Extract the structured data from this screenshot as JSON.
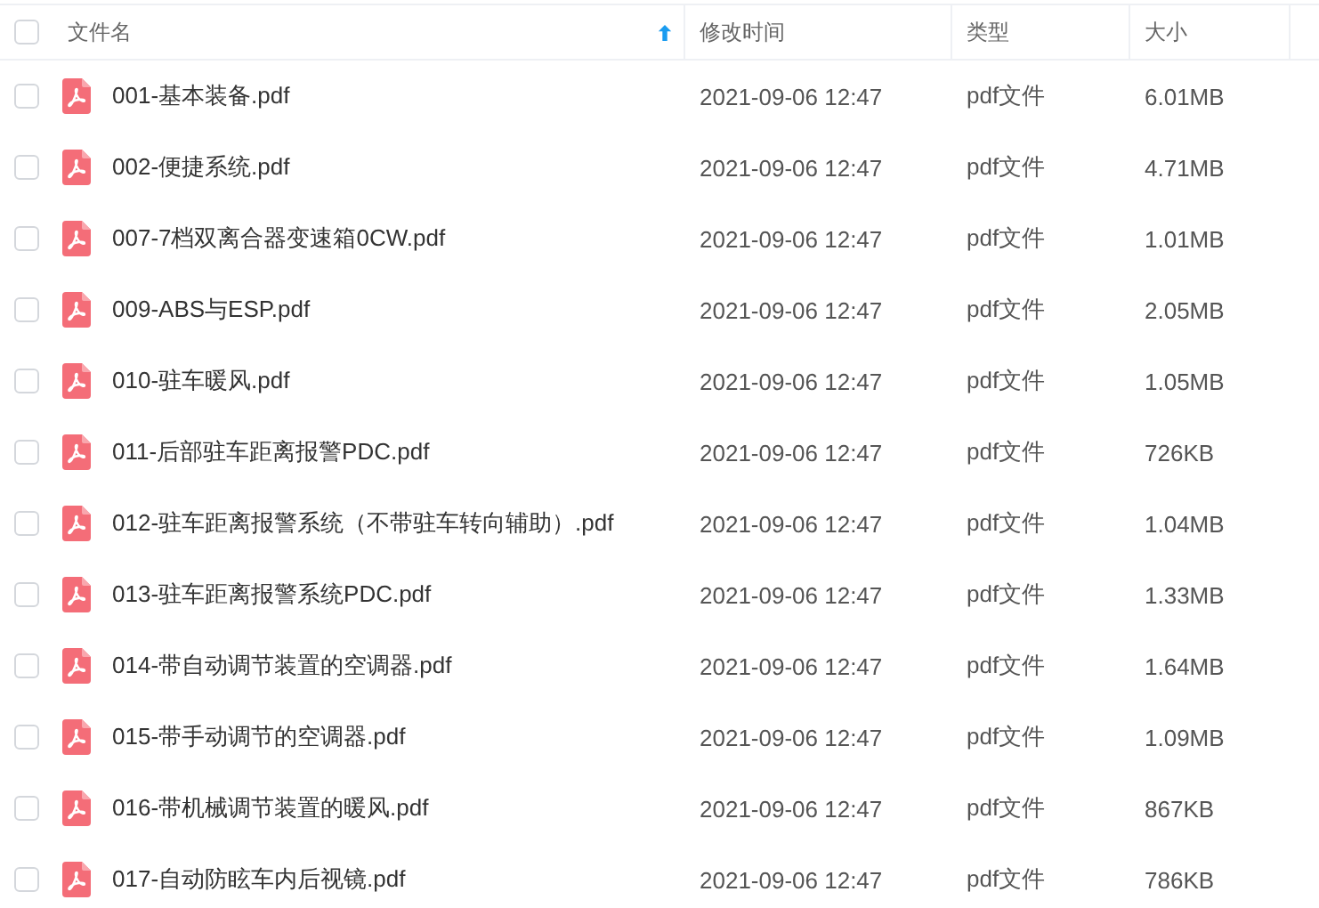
{
  "header": {
    "checked": false,
    "columns": [
      {
        "label": "文件名",
        "sorted": true
      },
      {
        "label": "修改时间",
        "sorted": false
      },
      {
        "label": "类型",
        "sorted": false
      },
      {
        "label": "大小",
        "sorted": false
      }
    ]
  },
  "rows": [
    {
      "checked": false,
      "name": "001-基本装备.pdf",
      "modified": "2021-09-06 12:47",
      "type": "pdf文件",
      "size": "6.01MB"
    },
    {
      "checked": false,
      "name": "002-便捷系统.pdf",
      "modified": "2021-09-06 12:47",
      "type": "pdf文件",
      "size": "4.71MB"
    },
    {
      "checked": false,
      "name": "007-7档双离合器变速箱0CW.pdf",
      "modified": "2021-09-06 12:47",
      "type": "pdf文件",
      "size": "1.01MB"
    },
    {
      "checked": false,
      "name": "009-ABS与ESP.pdf",
      "modified": "2021-09-06 12:47",
      "type": "pdf文件",
      "size": "2.05MB"
    },
    {
      "checked": false,
      "name": "010-驻车暖风.pdf",
      "modified": "2021-09-06 12:47",
      "type": "pdf文件",
      "size": "1.05MB"
    },
    {
      "checked": false,
      "name": "011-后部驻车距离报警PDC.pdf",
      "modified": "2021-09-06 12:47",
      "type": "pdf文件",
      "size": "726KB"
    },
    {
      "checked": false,
      "name": "012-驻车距离报警系统（不带驻车转向辅助）.pdf",
      "modified": "2021-09-06 12:47",
      "type": "pdf文件",
      "size": "1.04MB"
    },
    {
      "checked": false,
      "name": "013-驻车距离报警系统PDC.pdf",
      "modified": "2021-09-06 12:47",
      "type": "pdf文件",
      "size": "1.33MB"
    },
    {
      "checked": false,
      "name": "014-带自动调节装置的空调器.pdf",
      "modified": "2021-09-06 12:47",
      "type": "pdf文件",
      "size": "1.64MB"
    },
    {
      "checked": false,
      "name": "015-带手动调节的空调器.pdf",
      "modified": "2021-09-06 12:47",
      "type": "pdf文件",
      "size": "1.09MB"
    },
    {
      "checked": false,
      "name": "016-带机械调节装置的暖风.pdf",
      "modified": "2021-09-06 12:47",
      "type": "pdf文件",
      "size": "867KB"
    },
    {
      "checked": false,
      "name": "017-自动防眩车内后视镜.pdf",
      "modified": "2021-09-06 12:47",
      "type": "pdf文件",
      "size": "786KB"
    }
  ]
}
